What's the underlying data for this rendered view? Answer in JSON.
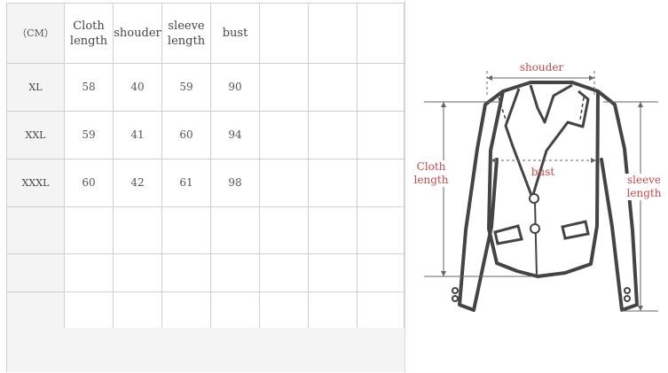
{
  "size_chart": {
    "unit_label": "（CM）",
    "columns": [
      {
        "line1": "Cloth",
        "line2": "length"
      },
      {
        "line1": "shouder",
        "line2": ""
      },
      {
        "line1": "sleeve",
        "line2": "length"
      },
      {
        "line1": "bust",
        "line2": ""
      }
    ],
    "rows": [
      {
        "size": "XL",
        "values": [
          "58",
          "40",
          "59",
          "90"
        ]
      },
      {
        "size": "XXL",
        "values": [
          "59",
          "41",
          "60",
          "94"
        ]
      },
      {
        "size": "XXXL",
        "values": [
          "60",
          "42",
          "61",
          "98"
        ]
      }
    ]
  },
  "diagram": {
    "shoulder_label": "shouder",
    "bust_label": "bust",
    "cloth_length_label": {
      "line1": "Cloth",
      "line2": "length"
    },
    "sleeve_length_label": {
      "line1": "sleeve",
      "line2": "length"
    },
    "label_color": "#c44a4a",
    "outline_color": "#444444",
    "measure_line_color": "#666666"
  }
}
